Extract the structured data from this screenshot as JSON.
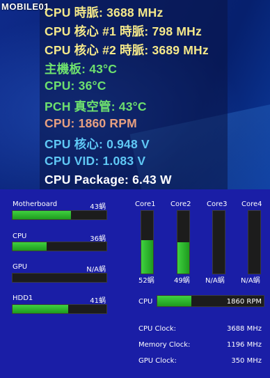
{
  "osd": {
    "logo": "MOBILE01",
    "lines": [
      {
        "text": "CPU 時脈: 3688 MHz",
        "color": "#f5e98a"
      },
      {
        "text": "CPU 核心 #1 時脈: 798 MHz",
        "color": "#f5e98a"
      },
      {
        "text": "CPU 核心 #2 時脈: 3689 MHz",
        "color": "#f5e98a"
      },
      {
        "text": "主機板: 43°C",
        "color": "#6ee06e"
      },
      {
        "text": "CPU: 36°C",
        "color": "#6ee06e"
      },
      {
        "text": "PCH 真空管: 43°C",
        "color": "#6ee06e"
      },
      {
        "text": "CPU: 1860 RPM",
        "color": "#e8a080"
      },
      {
        "text": "CPU 核心: 0.948 V",
        "color": "#5fc8f5"
      },
      {
        "text": "CPU VID: 1.083 V",
        "color": "#5fc8f5"
      },
      {
        "text": "CPU Package: 6.43 W",
        "color": "#ffffff"
      }
    ]
  },
  "temps": [
    {
      "label": "Motherboard",
      "value": "43蜗",
      "fill": 0.62
    },
    {
      "label": "CPU",
      "value": "36蜗",
      "fill": 0.36
    },
    {
      "label": "GPU",
      "value": "N/A蜗",
      "fill": 0
    },
    {
      "label": "HDD1",
      "value": "41蜗",
      "fill": 0.59
    }
  ],
  "cores": [
    {
      "label": "Core1",
      "value": "52蜗",
      "fill": 0.53
    },
    {
      "label": "Core2",
      "value": "49蜗",
      "fill": 0.5
    },
    {
      "label": "Core3",
      "value": "N/A蜗",
      "fill": 0
    },
    {
      "label": "Core4",
      "value": "N/A蜗",
      "fill": 0
    }
  ],
  "fan": {
    "label": "CPU",
    "value": "1860 RPM",
    "fill": 0.32
  },
  "clocks": [
    {
      "label": "CPU Clock:",
      "value": "3688 MHz"
    },
    {
      "label": "Memory Clock:",
      "value": "1196 MHz"
    },
    {
      "label": "GPU Clock:",
      "value": "350 MHz"
    }
  ]
}
